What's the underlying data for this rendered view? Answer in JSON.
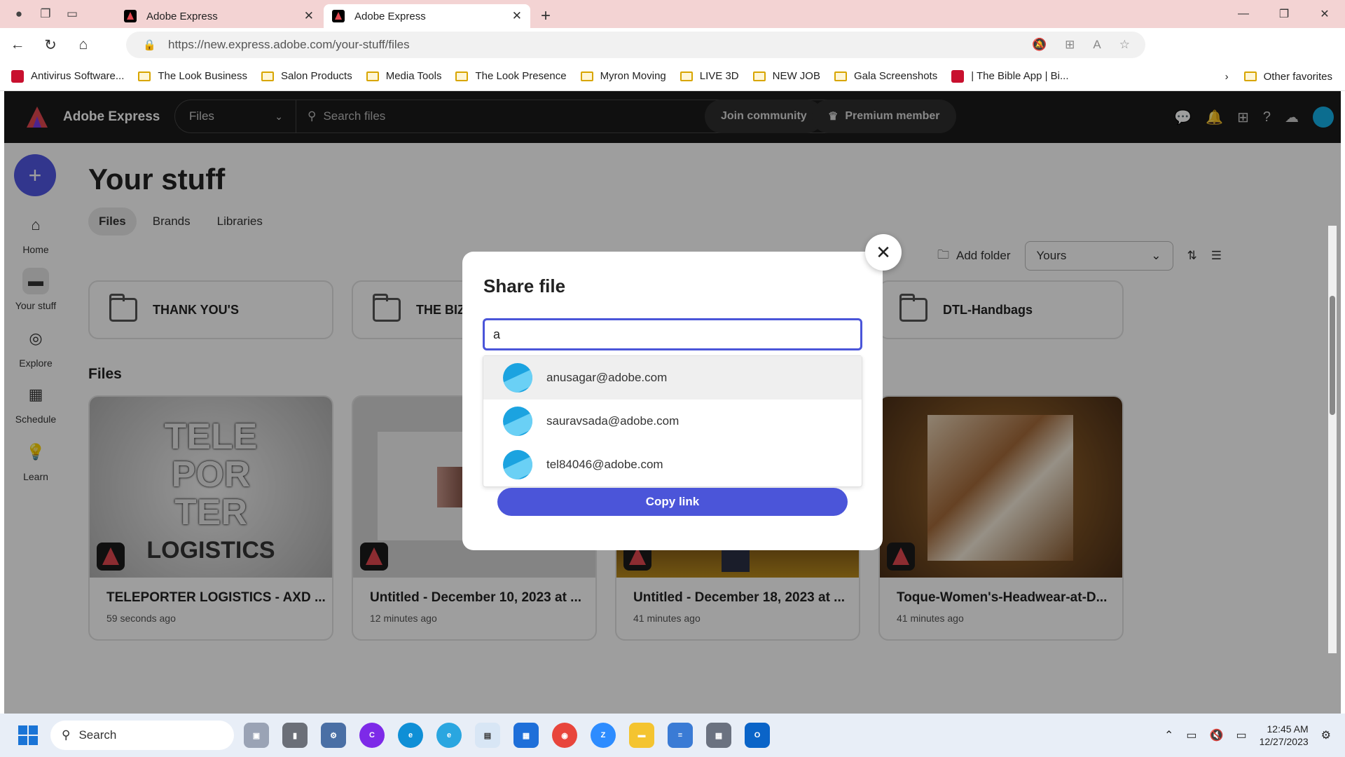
{
  "browser": {
    "tabs": [
      {
        "title": "Adobe Express"
      },
      {
        "title": "Adobe Express"
      }
    ],
    "url": "https://new.express.adobe.com/your-stuff/files",
    "bookmarks": [
      "Antivirus Software...",
      "The Look Business",
      "Salon Products",
      "Media Tools",
      "The Look Presence",
      "Myron Moving",
      "LIVE 3D",
      "NEW JOB",
      "Gala Screenshots",
      "| The Bible App | Bi..."
    ],
    "other_favorites": "Other favorites"
  },
  "header": {
    "app_name": "Adobe Express",
    "files_select": "Files",
    "search_placeholder": "Search files",
    "join_community": "Join community",
    "premium": "Premium member"
  },
  "rail": {
    "items": [
      {
        "label": "Home"
      },
      {
        "label": "Your stuff"
      },
      {
        "label": "Explore"
      },
      {
        "label": "Schedule"
      },
      {
        "label": "Learn"
      }
    ]
  },
  "main": {
    "title": "Your stuff",
    "tabs": [
      "Files",
      "Brands",
      "Libraries"
    ],
    "add_folder": "Add folder",
    "owner_filter": "Yours",
    "folders": [
      "THANK YOU'S",
      "THE BIZ",
      "DTL-Handbags"
    ],
    "files_heading": "Files",
    "files": [
      {
        "title": "TELEPORTER LOGISTICS - AXD ...",
        "time": "59 seconds ago"
      },
      {
        "title": "Untitled - December 10, 2023 at ...",
        "time": "12 minutes ago"
      },
      {
        "title": "Untitled - December 18, 2023 at ...",
        "time": "41 minutes ago"
      },
      {
        "title": "Toque-Women's-Headwear-at-D...",
        "time": "41 minutes ago"
      }
    ],
    "thumb_text": [
      "TELE",
      "POR",
      "TER",
      "LOGISTICS"
    ]
  },
  "modal": {
    "title": "Share file",
    "input_value": "a",
    "suggestions": [
      "anusagar@adobe.com",
      "sauravsada@adobe.com",
      "tel84046@adobe.com"
    ],
    "copy_link": "Copy link"
  },
  "taskbar": {
    "search": "Search",
    "time": "12:45 AM",
    "date": "12/27/2023"
  },
  "colors": {
    "accent": "#4b55d9",
    "header_bg": "#1b1b1b",
    "adobe_red": "#e34850"
  }
}
